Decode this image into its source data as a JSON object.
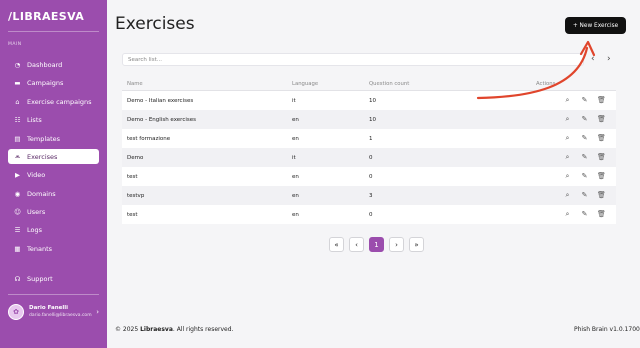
{
  "app": {
    "logo": "/LIBRAESVA",
    "section_label": "MAIN"
  },
  "sidebar": {
    "items": [
      {
        "label": "Dashboard",
        "icon": "dashboard-icon",
        "glyph": "◔",
        "active": false
      },
      {
        "label": "Campaigns",
        "icon": "campaigns-icon",
        "glyph": "▬",
        "active": false
      },
      {
        "label": "Exercise campaigns",
        "icon": "graduation-cap-icon",
        "glyph": "⌂",
        "active": false
      },
      {
        "label": "Lists",
        "icon": "lists-icon",
        "glyph": "☷",
        "active": false
      },
      {
        "label": "Templates",
        "icon": "templates-icon",
        "glyph": "▤",
        "active": false
      },
      {
        "label": "Exercises",
        "icon": "exercises-icon",
        "glyph": "⩕",
        "active": true
      },
      {
        "label": "Video",
        "icon": "video-icon",
        "glyph": "▶",
        "active": false
      },
      {
        "label": "Domains",
        "icon": "domains-icon",
        "glyph": "◉",
        "active": false
      },
      {
        "label": "Users",
        "icon": "users-icon",
        "glyph": "☺",
        "active": false
      },
      {
        "label": "Logs",
        "icon": "logs-icon",
        "glyph": "☰",
        "active": false
      },
      {
        "label": "Tenants",
        "icon": "tenants-icon",
        "glyph": "▦",
        "active": false
      },
      {
        "label": "Support",
        "icon": "headset-icon",
        "glyph": "☊",
        "active": false
      }
    ],
    "user": {
      "name": "Dario Fanelli",
      "email": "dario.fanelli@libraesva.com",
      "initials": "✿"
    }
  },
  "main": {
    "title": "Exercises",
    "new_button": "+ New Exercise",
    "search_placeholder": "Search list...",
    "pager_prev_arrow": "‹",
    "pager_next_arrow": "›"
  },
  "table": {
    "headers": {
      "name": "Name",
      "language": "Language",
      "count": "Question count",
      "actions": "Actions"
    },
    "rows": [
      {
        "name": "Demo - Italian exercises",
        "language": "it",
        "count": "10"
      },
      {
        "name": "Demo - English exercises",
        "language": "en",
        "count": "10"
      },
      {
        "name": "test formazione",
        "language": "en",
        "count": "1"
      },
      {
        "name": "Demo",
        "language": "it",
        "count": "0"
      },
      {
        "name": "test",
        "language": "en",
        "count": "0"
      },
      {
        "name": "testvp",
        "language": "en",
        "count": "3"
      },
      {
        "name": "test",
        "language": "en",
        "count": "0"
      }
    ],
    "action_icons": {
      "view": "⌕",
      "edit": "✎",
      "delete": "🗑"
    }
  },
  "pagination": {
    "first": "«",
    "prev": "‹",
    "current": "1",
    "next": "›",
    "last": "»"
  },
  "footer": {
    "copyright_prefix": "© 2025 ",
    "brand": "Libraesva",
    "copyright_suffix": ". All rights reserved.",
    "version": "Phish Brain v1.0.1700"
  },
  "colors": {
    "sidebar": "#9b4dad",
    "accent": "#9b4dad",
    "annotation": "#e0452c"
  }
}
